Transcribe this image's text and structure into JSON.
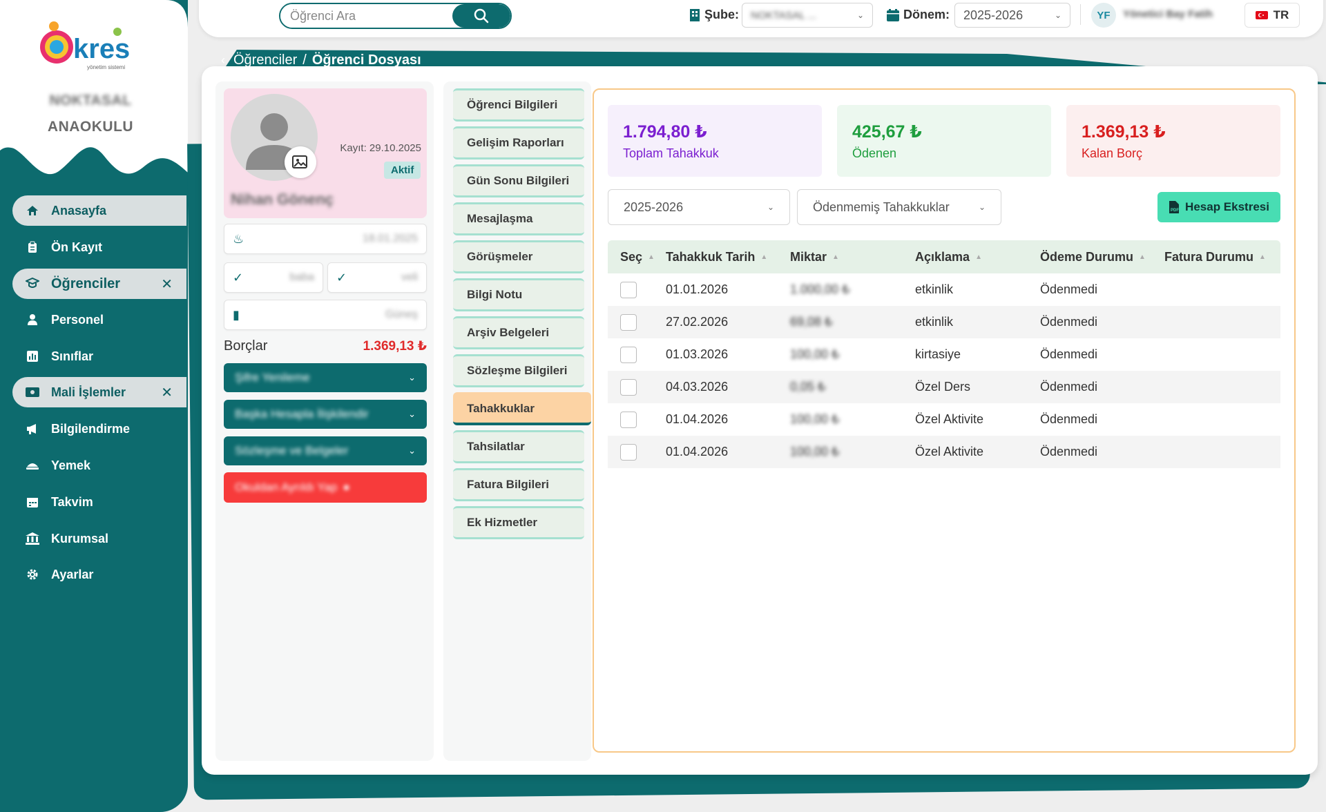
{
  "sidebar": {
    "school_line1": "NOKTASAL",
    "school_line2": "ANAOKULU",
    "logo_text": "kres",
    "logo_tagline": "yönetim sistemi",
    "items": [
      {
        "label": "Anasayfa",
        "icon": "home-icon"
      },
      {
        "label": "Ön Kayıt",
        "icon": "clipboard-icon"
      },
      {
        "label": "Öğrenciler",
        "icon": "student-icon",
        "close": "✕"
      },
      {
        "label": "Personel",
        "icon": "person-icon"
      },
      {
        "label": "Sınıflar",
        "icon": "chart-icon"
      },
      {
        "label": "Mali İşlemler",
        "icon": "money-icon",
        "close": "✕"
      },
      {
        "label": "Bilgilendirme",
        "icon": "megaphone-icon"
      },
      {
        "label": "Yemek",
        "icon": "food-icon"
      },
      {
        "label": "Takvim",
        "icon": "calendar-icon"
      },
      {
        "label": "Kurumsal",
        "icon": "building-icon"
      },
      {
        "label": "Ayarlar",
        "icon": "gear-icon"
      }
    ]
  },
  "topbar": {
    "search_placeholder": "Öğrenci Ara",
    "sube_label": "Şube:",
    "sube_value": "NOKTASAL ...",
    "donem_label": "Dönem:",
    "donem_value": "2025-2026",
    "user_initials": "YF",
    "user_name": "Yönetici Bay Fatih",
    "lang": "TR"
  },
  "breadcrumb": {
    "parent": "Öğrenciler",
    "sep": "/",
    "current": "Öğrenci Dosyası"
  },
  "student": {
    "kayit": "Kayıt: 29.10.2025",
    "status": "Aktif",
    "name": "Nihan Gönenç",
    "birth_date": "18.01.2025",
    "father": "baba",
    "mother": "veli",
    "class": "Güneş",
    "debt_label": "Borçlar",
    "debt_value": "1.369,13 ₺",
    "actions": [
      "Şifre Yenileme",
      "Başka Hesapla İlişkilendir",
      "Sözleşme ve Belgeler"
    ],
    "leave_label": "Okuldan Ayrıldı Yap"
  },
  "tabs": [
    "Öğrenci Bilgileri",
    "Gelişim Raporları",
    "Gün Sonu Bilgileri",
    "Mesajlaşma",
    "Görüşmeler",
    "Bilgi Notu",
    "Arşiv Belgeleri",
    "Sözleşme Bilgileri",
    "Tahakkuklar",
    "Tahsilatlar",
    "Fatura Bilgileri",
    "Ek Hizmetler"
  ],
  "active_tab": "Tahakkuklar",
  "stats": [
    {
      "value": "1.794,80 ₺",
      "label": "Toplam Tahakkuk",
      "color": "#7b1fd0",
      "bg": "#f6f0fc"
    },
    {
      "value": "425,67 ₺",
      "label": "Ödenen",
      "color": "#1e9e3e",
      "bg": "#ecf8ef"
    },
    {
      "value": "1.369,13 ₺",
      "label": "Kalan Borç",
      "color": "#d81f1f",
      "bg": "#fcefef"
    }
  ],
  "filters": {
    "period": "2025-2026",
    "status": "Ödenmemiş Tahakkuklar"
  },
  "statement_button": "Hesap Ekstresi",
  "table": {
    "headers": [
      "Seç",
      "Tahakkuk Tarih",
      "Miktar",
      "Açıklama",
      "Ödeme Durumu",
      "Fatura Durumu"
    ],
    "rows": [
      {
        "date": "01.01.2026",
        "amount": "1.000,00 ₺",
        "desc": "etkinlik",
        "pay": "Ödenmedi",
        "inv": ""
      },
      {
        "date": "27.02.2026",
        "amount": "69,08 ₺",
        "desc": "etkinlik",
        "pay": "Ödenmedi",
        "inv": ""
      },
      {
        "date": "01.03.2026",
        "amount": "100,00 ₺",
        "desc": "kirtasiye",
        "pay": "Ödenmedi",
        "inv": ""
      },
      {
        "date": "04.03.2026",
        "amount": "0,05 ₺",
        "desc": "Özel Ders",
        "pay": "Ödenmedi",
        "inv": ""
      },
      {
        "date": "01.04.2026",
        "amount": "100,00 ₺",
        "desc": "Özel Aktivite",
        "pay": "Ödenmedi",
        "inv": ""
      },
      {
        "date": "01.04.2026",
        "amount": "100,00 ₺",
        "desc": "Özel Aktivite",
        "pay": "Ödenmedi",
        "inv": ""
      }
    ]
  }
}
